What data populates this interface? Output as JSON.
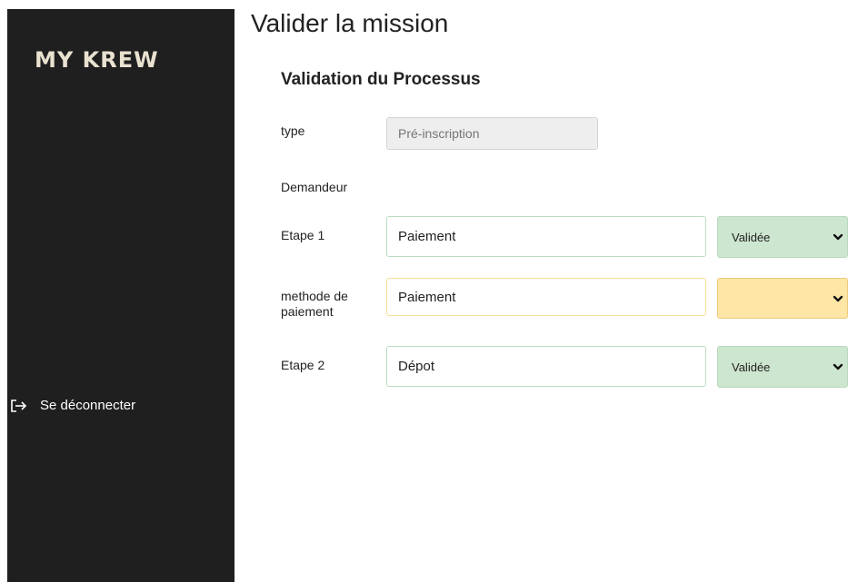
{
  "sidebar": {
    "logo": "MY KREW",
    "logout_label": "Se déconnecter",
    "logout_icon": "sign-out-icon"
  },
  "page": {
    "title": "Valider la mission",
    "section_title": "Validation du Processus"
  },
  "form": {
    "type": {
      "label": "type",
      "placeholder": "Pré-inscription",
      "value": ""
    },
    "demandeur": {
      "label": "Demandeur"
    },
    "etape1": {
      "label": "Etape 1",
      "value": "Paiement",
      "status": "Validée"
    },
    "methode": {
      "label": "methode de paiement",
      "value": "Paiement",
      "status": ""
    },
    "etape2": {
      "label": "Etape 2",
      "value": "Dépot",
      "status": "Validée"
    }
  },
  "colors": {
    "sidebar_bg": "#1f1f1f",
    "logo": "#e9e2d0",
    "valid_green": "#cde6cf",
    "pending_yellow": "#fde6a6"
  }
}
